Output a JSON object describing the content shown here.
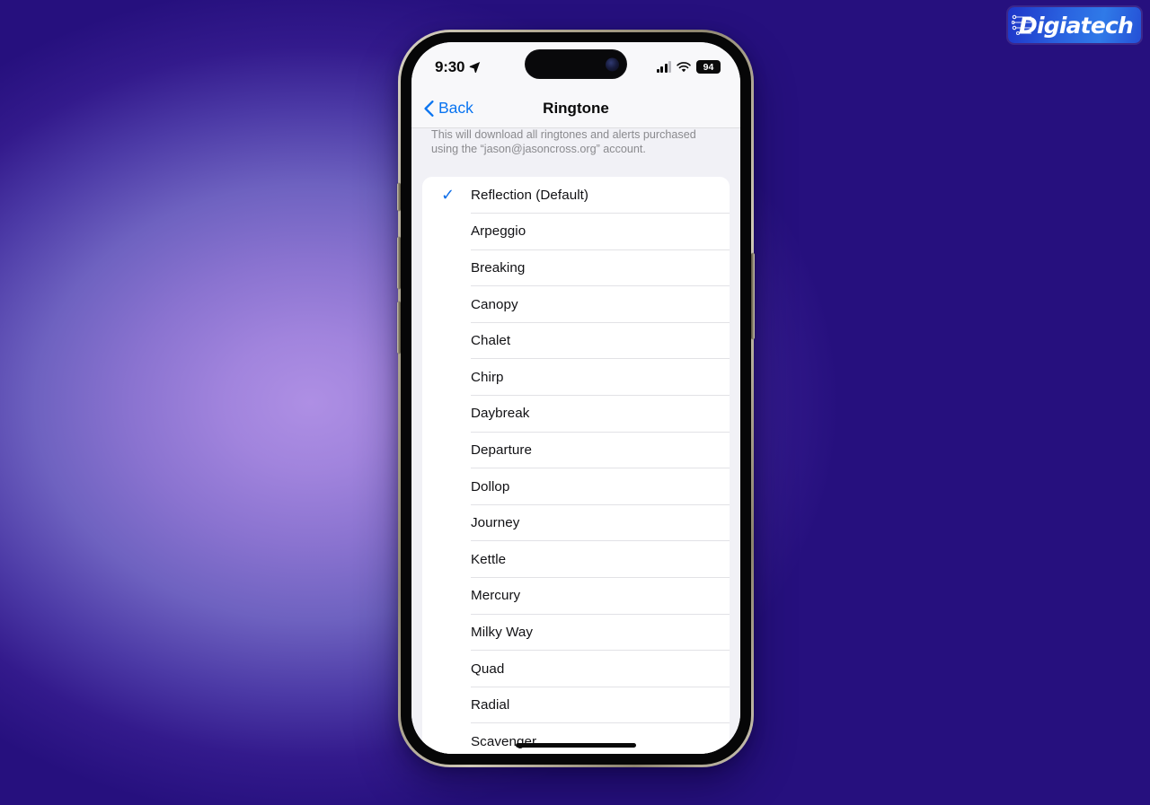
{
  "logo": {
    "brand": "Digiatech",
    "icon": "circuit-lines-icon",
    "bg_start": "#1e35c8",
    "bg_end": "#2f7ae8"
  },
  "background": {
    "center_color": "#a184dd",
    "mid_color": "#6e62c0",
    "edge_color": "#26107e"
  },
  "phone": {
    "frame_color": "#b4ab97",
    "bezel_color": "#060607",
    "buttons": [
      {
        "name": "silent-switch"
      },
      {
        "name": "volume-up-button"
      },
      {
        "name": "volume-down-button"
      },
      {
        "name": "power-button"
      }
    ]
  },
  "status_bar": {
    "time": "9:30",
    "location_icon": "location-arrow-icon",
    "signal_icon": "cellular-signal-icon",
    "signal_bars_filled": 3,
    "signal_bars_total": 4,
    "wifi_icon": "wifi-icon",
    "battery_icon": "battery-icon",
    "battery_percent": "94",
    "dynamic_island": "dynamic-island",
    "camera_icon": "front-camera-icon"
  },
  "nav_bar": {
    "back_icon": "chevron-left-icon",
    "back_label": "Back",
    "title": "Ringtone",
    "accent_color": "#0a74f0"
  },
  "footer_note": "This will download all ringtones and alerts purchased using the “jason@jasoncross.org” account.",
  "selection": {
    "check_icon": "checkmark-icon",
    "check_color": "#1270e8",
    "selected_index": 0
  },
  "ringtones": [
    {
      "label": "Reflection (Default)",
      "selected": true
    },
    {
      "label": "Arpeggio",
      "selected": false
    },
    {
      "label": "Breaking",
      "selected": false
    },
    {
      "label": "Canopy",
      "selected": false
    },
    {
      "label": "Chalet",
      "selected": false
    },
    {
      "label": "Chirp",
      "selected": false
    },
    {
      "label": "Daybreak",
      "selected": false
    },
    {
      "label": "Departure",
      "selected": false
    },
    {
      "label": "Dollop",
      "selected": false
    },
    {
      "label": "Journey",
      "selected": false
    },
    {
      "label": "Kettle",
      "selected": false
    },
    {
      "label": "Mercury",
      "selected": false
    },
    {
      "label": "Milky Way",
      "selected": false
    },
    {
      "label": "Quad",
      "selected": false
    },
    {
      "label": "Radial",
      "selected": false
    },
    {
      "label": "Scavenger",
      "selected": false
    }
  ]
}
